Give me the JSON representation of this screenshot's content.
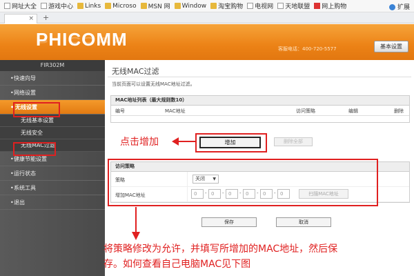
{
  "browser": {
    "bookmarks": [
      {
        "label": "网址大全",
        "icon": "page-icon"
      },
      {
        "label": "游戏中心",
        "icon": "page-icon"
      },
      {
        "label": "Links",
        "icon": "folder-icon"
      },
      {
        "label": "Microso",
        "icon": "folder-icon"
      },
      {
        "label": "MSN 网",
        "icon": "folder-icon"
      },
      {
        "label": "Window",
        "icon": "folder-icon"
      },
      {
        "label": "淘宝购物",
        "icon": "folder-icon"
      },
      {
        "label": "电视网",
        "icon": "page-icon"
      },
      {
        "label": "天地联盟",
        "icon": "page-icon"
      },
      {
        "label": "网上购物",
        "icon": "red-icon"
      }
    ],
    "extensions_label": "扩展",
    "tab_close": "×",
    "new_tab": "+"
  },
  "header": {
    "logo": "PHICOMM",
    "hotline": "客服电话：400-720-5577",
    "basic_settings_label": "基本设置"
  },
  "sidebar": {
    "model": "FIR302M",
    "items": [
      {
        "label": "快速向导"
      },
      {
        "label": "网络设置"
      },
      {
        "label": "无线设置"
      },
      {
        "label": "无线基本设置"
      },
      {
        "label": "无线安全"
      },
      {
        "label": "无线MAC过滤"
      },
      {
        "label": "健康节能设置"
      },
      {
        "label": "运行状态"
      },
      {
        "label": "系统工具"
      },
      {
        "label": "退出"
      }
    ]
  },
  "main": {
    "title": "无线MAC过滤",
    "description": "当前页面可以设置无线MAC地址过滤。",
    "mac_list": {
      "caption": "MAC地址列表（最大规则数10）",
      "columns": [
        "编号",
        "MAC地址",
        "访问策略",
        "编辑",
        "删除"
      ]
    },
    "add_button": "增加",
    "delete_all_button": "删除全部",
    "policy": {
      "caption": "访问策略",
      "policy_label": "策略",
      "policy_value": "关闭",
      "add_mac_label": "增加MAC地址",
      "mac_fields": [
        "0",
        "0",
        "0",
        "0",
        "0",
        "0"
      ],
      "scan_button": "扫描MAC地址"
    },
    "save_button": "保存",
    "cancel_button": "取消"
  },
  "annotations": {
    "click_add": "点击增加",
    "instruction_line1": "将策略修改为允许，并填写所增加的MAC地址，然后保",
    "instruction_line2": "存。如何查看自己电脑MAC见下图",
    "color": "#e02020"
  }
}
